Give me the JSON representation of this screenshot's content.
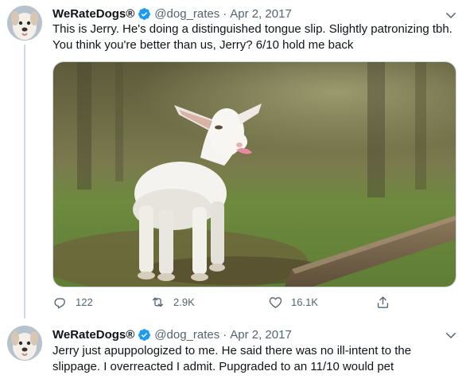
{
  "tweets": [
    {
      "author": {
        "name": "WeRateDogs®",
        "handle": "@dog_rates",
        "verified": true
      },
      "separator": "·",
      "date": "Apr 2, 2017",
      "text": "This is Jerry. He's doing a distinguished tongue slip. Slightly patronizing tbh. You think you're better than us, Jerry? 6/10 hold me back",
      "media": {
        "kind": "photo",
        "subject": "white baby goat sticking its tongue out on grass"
      },
      "actions": {
        "replies": "122",
        "retweets": "2.9K",
        "likes": "16.1K"
      }
    },
    {
      "author": {
        "name": "WeRateDogs®",
        "handle": "@dog_rates",
        "verified": true
      },
      "separator": "·",
      "date": "Apr 2, 2017",
      "text": "Jerry just apuppologized to me. He said there was no ill-intent to the slippage. I overreacted I admit. Pupgraded to an 11/10 would pet"
    }
  ],
  "colors": {
    "verified": "#1d9bf0",
    "muted": "#536471",
    "thread_line": "#cfd9de"
  },
  "icons": [
    "caret-down-icon",
    "verified-badge-icon",
    "reply-icon",
    "retweet-icon",
    "like-icon",
    "share-icon"
  ]
}
